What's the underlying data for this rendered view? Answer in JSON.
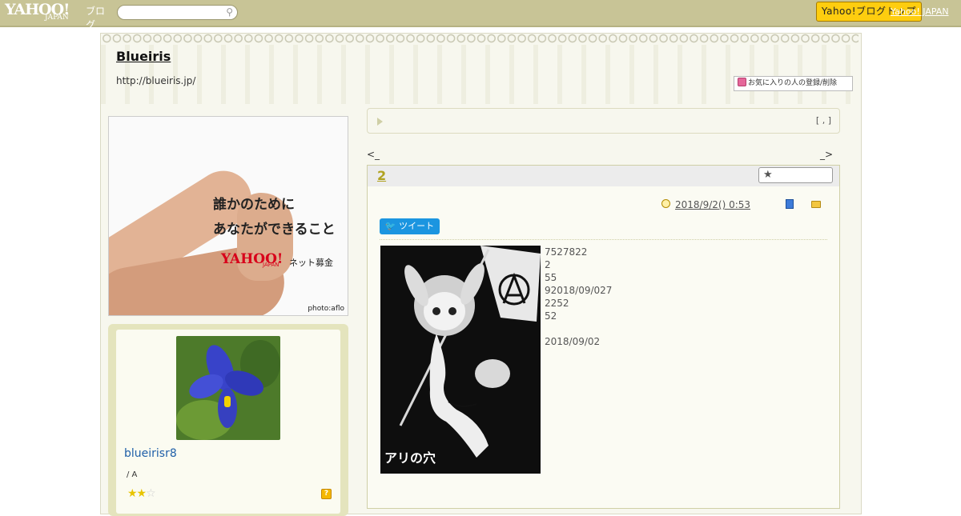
{
  "header": {
    "logo_main": "YAHOO!",
    "logo_sub": "JAPAN",
    "logo_suffix": "ブログ",
    "search_placeholder": "",
    "top_button": "Yahoo!ブログトップ",
    "top_link": "Yahoo! JAPAN"
  },
  "blog": {
    "title": "Blueiris",
    "url": "http://blueiris.jp/",
    "fav_button": "お気に入りの人の登録/削除"
  },
  "ad": {
    "line1": "誰かのために",
    "line2": "あなたができること",
    "brand": "YAHOO!",
    "brand_sub": "JAPAN",
    "brand_suffix": "ネット募金",
    "credit": "photo:aflo"
  },
  "profile": {
    "username": "blueirisr8",
    "text": "/ A",
    "stars_on": "★★",
    "stars_off": "☆",
    "help_icon": "?"
  },
  "notice": {
    "bracket": "[ , ]"
  },
  "nav": {
    "prev": "<_",
    "next": "_>"
  },
  "article": {
    "title": "2",
    "star_button": "★",
    "date": "2018/9/2()  0:53",
    "tweet": "ツイート",
    "image_caption": "アリの穴",
    "lines": [
      "7527822",
      "2",
      "55",
      "92018/09/027",
      "2252",
      "52",
      "",
      "2018/09/02"
    ]
  },
  "icons": {
    "search": "search-icon",
    "heart": "heart-icon",
    "clock": "clock-icon",
    "book": "book-icon",
    "folder": "folder-icon",
    "help": "help-icon",
    "triangle": "triangle-icon"
  },
  "colors": {
    "topbar": "#c8c496",
    "accent_button": "#fecd0f",
    "title_gold": "#b0a220",
    "username_blue": "#1f5fa8",
    "twitter": "#1b95e0"
  }
}
